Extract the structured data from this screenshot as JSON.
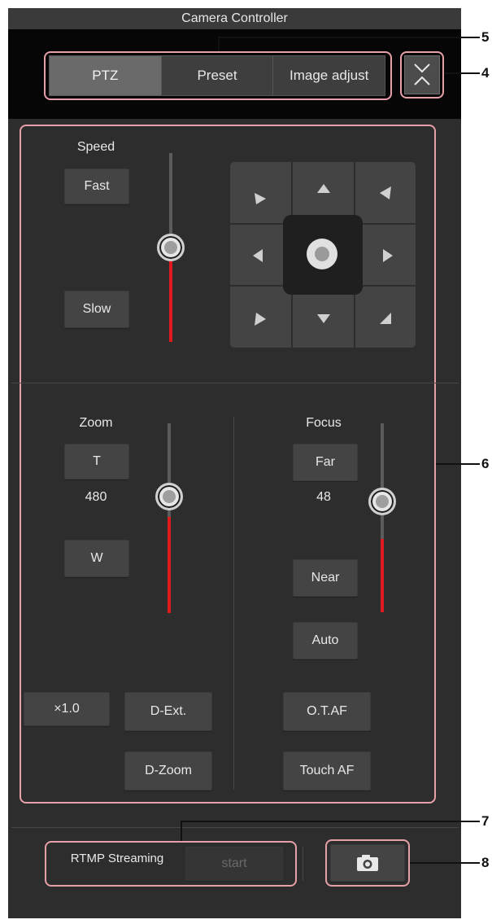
{
  "window": {
    "title": "Camera Controller"
  },
  "tabs": [
    {
      "label": "PTZ",
      "active": true
    },
    {
      "label": "Preset",
      "active": false
    },
    {
      "label": "Image adjust",
      "active": false
    }
  ],
  "speed": {
    "label": "Speed",
    "fast_label": "Fast",
    "slow_label": "Slow",
    "slider_level": 0.5
  },
  "zoom": {
    "label": "Zoom",
    "tele_label": "T",
    "wide_label": "W",
    "value": "480",
    "slider_level": 0.47,
    "x10_label": "×1.0",
    "dext_label": "D-Ext.",
    "dzoom_label": "D-Zoom"
  },
  "focus": {
    "label": "Focus",
    "far_label": "Far",
    "near_label": "Near",
    "value": "48",
    "slider_level": 0.5,
    "auto_label": "Auto",
    "otaf_label": "O.T.AF",
    "touchaf_label": "Touch AF"
  },
  "streaming": {
    "label": "RTMP Streaming",
    "start_label": "start"
  },
  "snapshot": {
    "icon": "camera-icon"
  },
  "callouts": [
    "5",
    "4",
    "6",
    "7",
    "8"
  ],
  "colors": {
    "accent_red": "#e0191e",
    "panel": "#2d2d2d",
    "callout": "#e8a0a8"
  }
}
